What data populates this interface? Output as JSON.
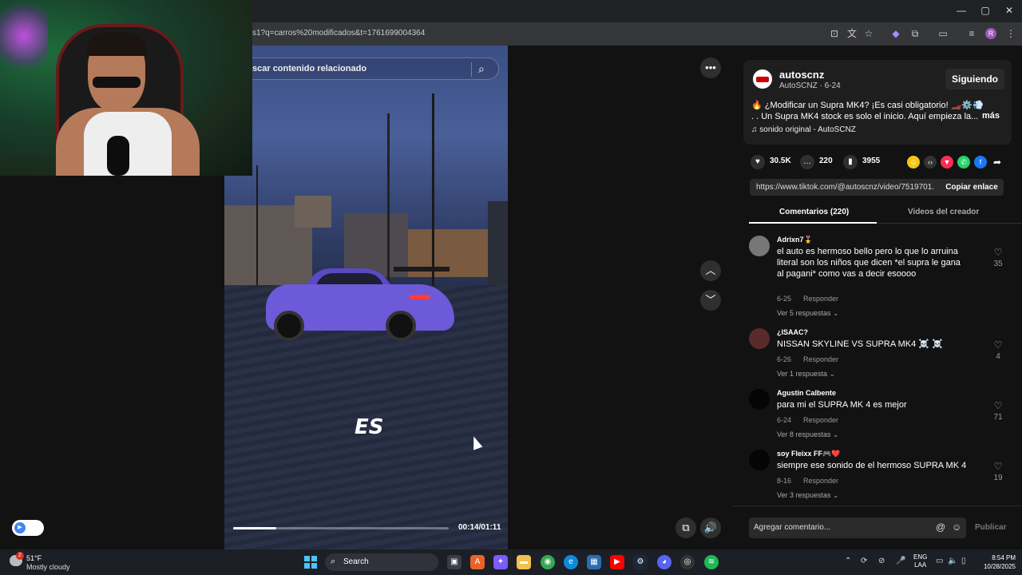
{
  "browser": {
    "url": "s1?q=carros%20modificados&t=1761699004364",
    "window_controls": [
      "—",
      "▢",
      "✕"
    ],
    "profile_initial": "R"
  },
  "video": {
    "search_placeholder": "scar contenido relacionado",
    "overlay_text": "ES",
    "time": "00:14/01:11",
    "progress": 0.2
  },
  "author": {
    "name": "autoscnz",
    "subtitle": "AutoSCNZ · 6-24",
    "follow_label": "Siguiendo",
    "description": "🔥 ¿Modificar un Supra MK4? ¡Es casi obligatorio! 🏎️⚙️💨 . . Un Supra MK4 stock es solo el inicio. Aquí empieza la...",
    "more_label": "más",
    "sound": "♫  sonido original - AutoSCNZ"
  },
  "stats": {
    "likes": "30.5K",
    "comments": "220",
    "saves": "3955"
  },
  "link": {
    "url": "https://www.tiktok.com/@autoscnz/video/7519701...",
    "copy_label": "Copiar enlace"
  },
  "tabs": {
    "comments": "Comentarios (220)",
    "creator_videos": "Videos del creador"
  },
  "comments": [
    {
      "user": "Adrixn7🎖️",
      "text": "el auto es hermoso bello pero lo que lo arruina literal son los niños que dicen *el supra le gana al pagani* como vas a decir esoooo",
      "date": "6-25",
      "reply": "Responder",
      "more": "Ver 5 respuestas ⌄",
      "likes": "35"
    },
    {
      "user": "¿ISAAC?",
      "text": "NISSAN SKYLINE VS SUPRA MK4 ☠️ ☠️",
      "date": "6-26",
      "reply": "Responder",
      "more": "Ver 1 respuesta ⌄",
      "likes": "4"
    },
    {
      "user": "Agustin Calbente",
      "text": "para mi el SUPRA MK 4 es mejor",
      "date": "6-24",
      "reply": "Responder",
      "more": "Ver 8 respuestas ⌄",
      "likes": "71"
    },
    {
      "user": "soy Fleixx FF🎮❤️",
      "text": "siempre ese sonido de el hermoso SUPRA MK 4",
      "date": "8-16",
      "reply": "Responder",
      "more": "Ver 3 respuestas ⌄",
      "likes": "19"
    }
  ],
  "comment_bar": {
    "placeholder": "Agregar comentario...",
    "publish_label": "Publicar"
  },
  "taskbar": {
    "weather_temp": "51°F",
    "weather_desc": "Mostly cloudy",
    "search_label": "Search",
    "lang_line1": "ENG",
    "lang_line2": "LAA",
    "time": "8:54 PM",
    "date": "10/28/2025",
    "notification_count": "2"
  }
}
